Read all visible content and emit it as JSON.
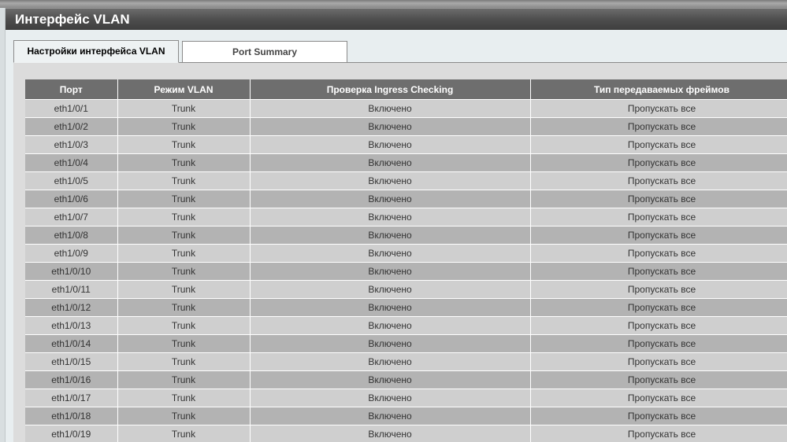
{
  "window": {
    "title": "Интерфейс VLAN"
  },
  "tabs": [
    {
      "label": "Настройки интерфейса VLAN",
      "active": true
    },
    {
      "label": "Port Summary",
      "active": false
    }
  ],
  "table": {
    "headers": [
      "Порт",
      "Режим VLAN",
      "Проверка Ingress Checking",
      "Тип передаваемых фреймов"
    ],
    "rows": [
      [
        "eth1/0/1",
        "Trunk",
        "Включено",
        "Пропускать все"
      ],
      [
        "eth1/0/2",
        "Trunk",
        "Включено",
        "Пропускать все"
      ],
      [
        "eth1/0/3",
        "Trunk",
        "Включено",
        "Пропускать все"
      ],
      [
        "eth1/0/4",
        "Trunk",
        "Включено",
        "Пропускать все"
      ],
      [
        "eth1/0/5",
        "Trunk",
        "Включено",
        "Пропускать все"
      ],
      [
        "eth1/0/6",
        "Trunk",
        "Включено",
        "Пропускать все"
      ],
      [
        "eth1/0/7",
        "Trunk",
        "Включено",
        "Пропускать все"
      ],
      [
        "eth1/0/8",
        "Trunk",
        "Включено",
        "Пропускать все"
      ],
      [
        "eth1/0/9",
        "Trunk",
        "Включено",
        "Пропускать все"
      ],
      [
        "eth1/0/10",
        "Trunk",
        "Включено",
        "Пропускать все"
      ],
      [
        "eth1/0/11",
        "Trunk",
        "Включено",
        "Пропускать все"
      ],
      [
        "eth1/0/12",
        "Trunk",
        "Включено",
        "Пропускать все"
      ],
      [
        "eth1/0/13",
        "Trunk",
        "Включено",
        "Пропускать все"
      ],
      [
        "eth1/0/14",
        "Trunk",
        "Включено",
        "Пропускать все"
      ],
      [
        "eth1/0/15",
        "Trunk",
        "Включено",
        "Пропускать все"
      ],
      [
        "eth1/0/16",
        "Trunk",
        "Включено",
        "Пропускать все"
      ],
      [
        "eth1/0/17",
        "Trunk",
        "Включено",
        "Пропускать все"
      ],
      [
        "eth1/0/18",
        "Trunk",
        "Включено",
        "Пропускать все"
      ],
      [
        "eth1/0/19",
        "Trunk",
        "Включено",
        "Пропускать все"
      ]
    ]
  }
}
